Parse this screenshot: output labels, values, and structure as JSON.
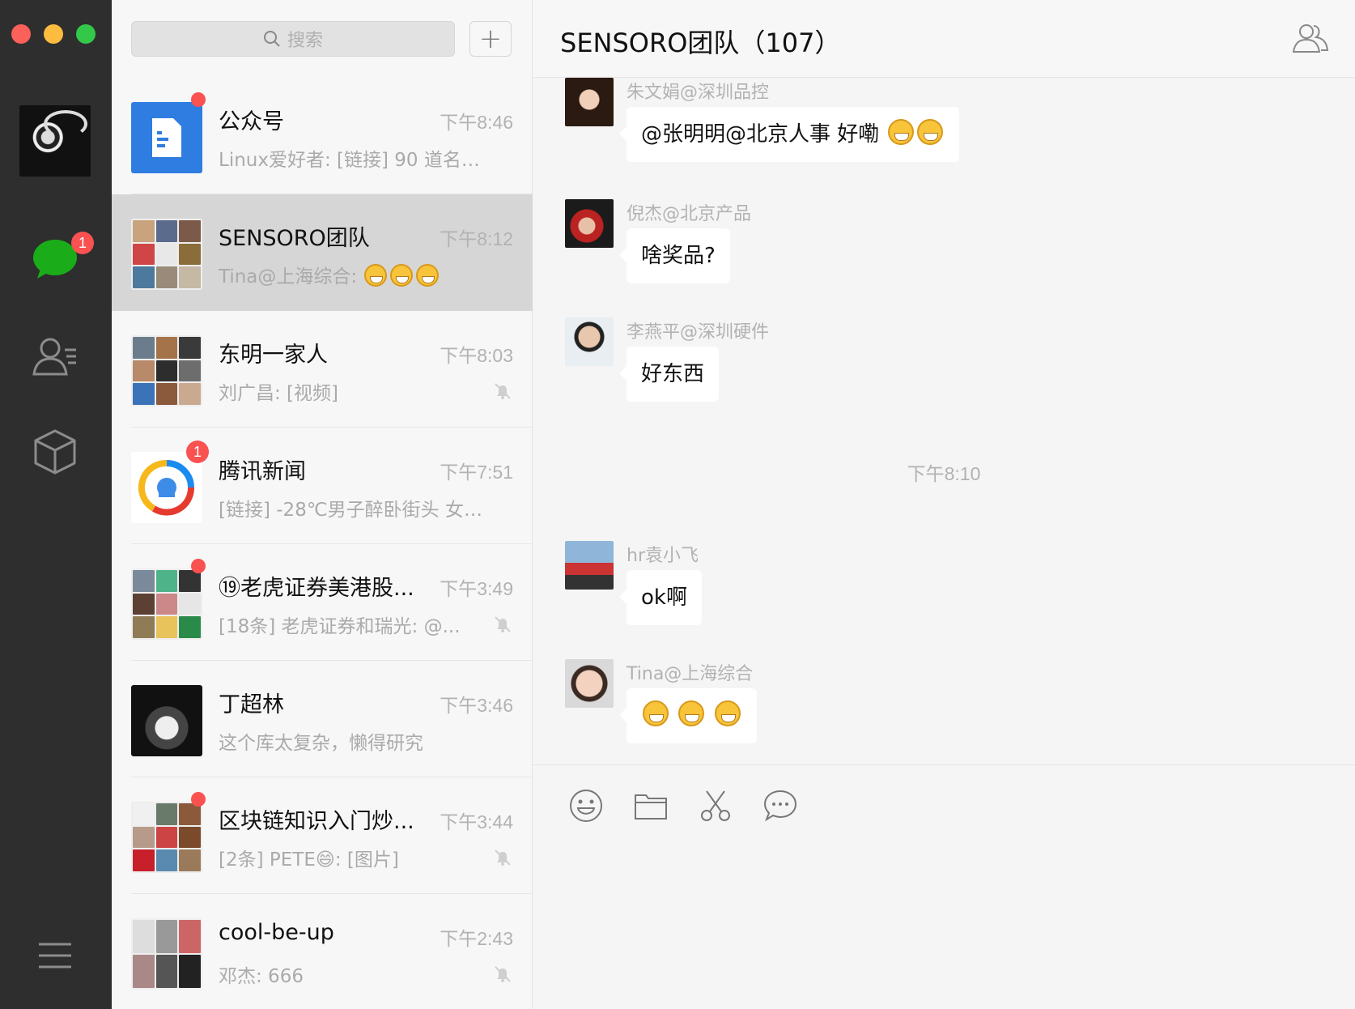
{
  "search": {
    "placeholder": "搜索"
  },
  "sidebar": {
    "chats_badge": "1"
  },
  "chat_list": [
    {
      "name": "公众号",
      "time": "下午8:46",
      "preview": "Linux爱好者: [链接] 90 道名企...",
      "badge": "",
      "dot": true,
      "muted": false
    },
    {
      "name": "SENSORO团队",
      "time": "下午8:12",
      "preview": "Tina@上海综合: ",
      "badge": "",
      "dot": false,
      "muted": false,
      "emoji_count": 3
    },
    {
      "name": "东明一家人",
      "time": "下午8:03",
      "preview": "刘广昌: [视频]",
      "badge": "",
      "dot": false,
      "muted": true
    },
    {
      "name": "腾讯新闻",
      "time": "下午7:51",
      "preview": "[链接] -28℃男子醉卧街头 女司...",
      "badge": "1",
      "dot": false,
      "muted": false
    },
    {
      "name": "⑲老虎证券美港股...",
      "time": "下午3:49",
      "preview": "[18条] 老虎证券和瑞光: @...",
      "badge": "",
      "dot": true,
      "muted": true
    },
    {
      "name": "丁超林",
      "time": "下午3:46",
      "preview": "这个库太复杂，懒得研究",
      "badge": "",
      "dot": false,
      "muted": false
    },
    {
      "name": "区块链知识入门炒...",
      "time": "下午3:44",
      "preview": "[2条] PETE😄: [图片]",
      "badge": "",
      "dot": true,
      "muted": true
    },
    {
      "name": "cool-be-up",
      "time": "下午2:43",
      "preview": "邓杰: 666",
      "badge": "",
      "dot": false,
      "muted": true
    }
  ],
  "conversation": {
    "title": "SENSORO团队（107）",
    "time_separator": "下午8:10",
    "messages": [
      {
        "sender": "朱文娟@深圳品控",
        "text": "@张明明@北京人事 好嘞",
        "emoji_count": 2
      },
      {
        "sender": "倪杰@北京产品",
        "text": "啥奖品?",
        "emoji_count": 0
      },
      {
        "sender": "李燕平@深圳硬件",
        "text": "好东西",
        "emoji_count": 0
      },
      {
        "sender": "hr袁小飞",
        "text": "ok啊",
        "emoji_count": 0
      },
      {
        "sender": "Tina@上海综合",
        "text": "",
        "emoji_count": 3
      }
    ]
  },
  "colors": {
    "accent_green": "#1aad19",
    "badge_red": "#fa5151",
    "selected_row": "#d6d6d6",
    "sidebar_bg": "#2e2e2e"
  },
  "icons": [
    "search-icon",
    "plus-icon",
    "chat-icon",
    "contacts-icon",
    "box-icon",
    "menu-icon",
    "group-members-icon",
    "emoji-icon",
    "folder-icon",
    "scissors-icon",
    "chat-bubble-icon",
    "mute-bell-icon"
  ]
}
